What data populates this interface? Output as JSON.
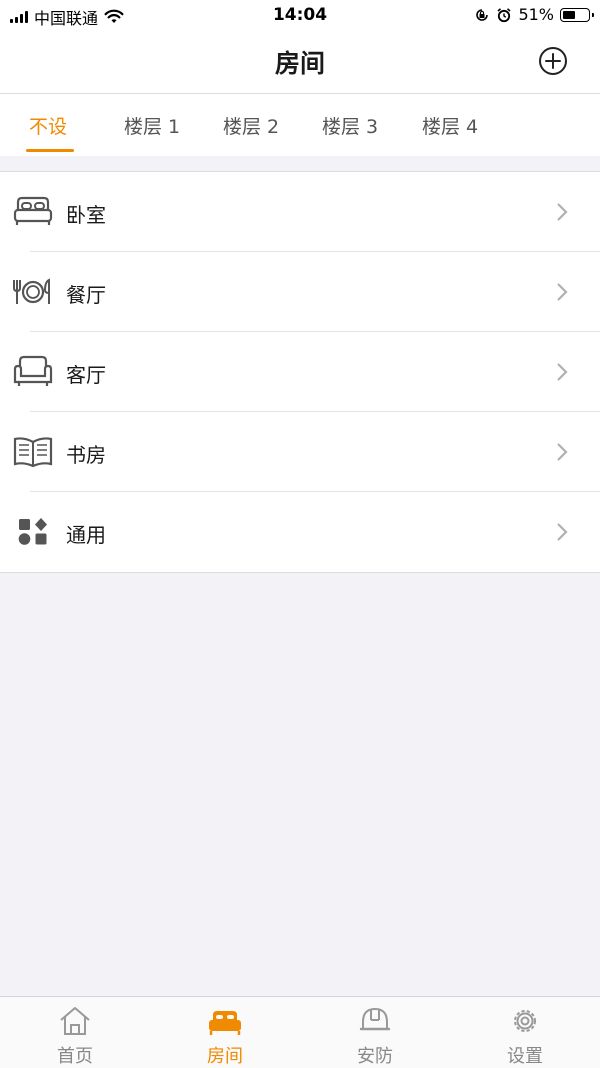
{
  "status_bar": {
    "carrier": "中国联通",
    "time": "14:04",
    "battery": "51%",
    "battery_level": 0.51
  },
  "header": {
    "title": "房间",
    "add_icon": "plus-circle-icon"
  },
  "floor_tabs": [
    {
      "label": "不设",
      "active": true
    },
    {
      "label": "楼层 1",
      "active": false
    },
    {
      "label": "楼层 2",
      "active": false
    },
    {
      "label": "楼层 3",
      "active": false
    },
    {
      "label": "楼层 4",
      "active": false
    }
  ],
  "rooms": [
    {
      "label": "卧室",
      "icon": "bed-icon"
    },
    {
      "label": "餐厅",
      "icon": "dining-icon"
    },
    {
      "label": "客厅",
      "icon": "sofa-icon"
    },
    {
      "label": "书房",
      "icon": "book-icon"
    },
    {
      "label": "通用",
      "icon": "apps-icon"
    }
  ],
  "bottom_tabs": [
    {
      "label": "首页",
      "icon": "home-icon",
      "active": false
    },
    {
      "label": "房间",
      "icon": "bed-icon",
      "active": true
    },
    {
      "label": "安防",
      "icon": "helmet-icon",
      "active": false
    },
    {
      "label": "设置",
      "icon": "gear-icon",
      "active": false
    }
  ],
  "colors": {
    "accent": "#f08a00",
    "text": "#1a1a1a",
    "inactive": "#888888",
    "background": "#f2f2f7"
  }
}
